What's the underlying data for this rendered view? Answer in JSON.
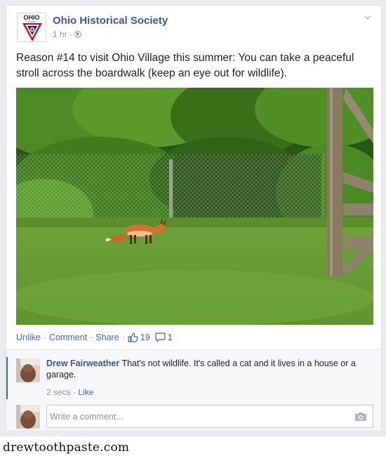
{
  "post": {
    "page_name": "Ohio Historical Society",
    "logo_text": "OHIO",
    "logo_sub": "HISTORY",
    "time": "1 hr",
    "time_sep": "·",
    "text": "Reason #14 to visit Ohio Village this summer: You can take a peaceful stroll across the boardwalk (keep an eye out for wildlife)."
  },
  "actions": {
    "unlike": "Unlike",
    "comment": "Comment",
    "share": "Share",
    "sep": "·",
    "likes_count": "19",
    "comments_count": "1"
  },
  "comment": {
    "author": "Drew Fairweather",
    "text": "That's not wildlife. It's called a cat and it lives in a house or a garage.",
    "time": "2 secs",
    "sep": "·",
    "like": "Like"
  },
  "composer": {
    "placeholder": "Write a comment..."
  },
  "watermark": "drewtoothpaste.com",
  "colors": {
    "link": "#365899",
    "action_blue": "#4267b2",
    "meta_gray": "#90949c"
  }
}
